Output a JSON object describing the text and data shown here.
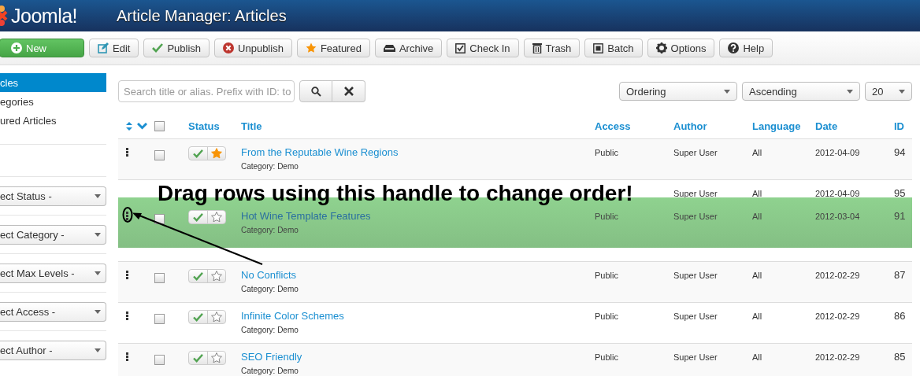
{
  "header": {
    "logo": "Joomla!",
    "title": "Article Manager: Articles"
  },
  "toolbar": [
    {
      "label": "New",
      "kind": "primary"
    },
    {
      "label": "Edit",
      "kind": "default"
    },
    {
      "label": "Publish",
      "kind": "default"
    },
    {
      "label": "Unpublish",
      "kind": "default"
    },
    {
      "label": "Featured",
      "kind": "default"
    },
    {
      "label": "Archive",
      "kind": "default"
    },
    {
      "label": "Check In",
      "kind": "default"
    },
    {
      "label": "Trash",
      "kind": "default"
    },
    {
      "label": "Batch",
      "kind": "default"
    },
    {
      "label": "Options",
      "kind": "default"
    },
    {
      "label": "Help",
      "kind": "default"
    }
  ],
  "sidebar": {
    "items": [
      {
        "label": "cles",
        "selected": true
      },
      {
        "label": "egories",
        "selected": false
      },
      {
        "label": "ured Articles",
        "selected": false
      }
    ],
    "filters": [
      {
        "value": "ect Status -"
      },
      {
        "value": "ect Category -"
      },
      {
        "value": "ect Max Levels -"
      },
      {
        "value": "ect Access -"
      },
      {
        "value": "ect Author -"
      }
    ]
  },
  "search": {
    "placeholder": "Search title or alias. Prefix with ID: to"
  },
  "list_controls": [
    {
      "value": "Ordering"
    },
    {
      "value": "Ascending"
    },
    {
      "value": "20"
    }
  ],
  "table": {
    "header_checked": false,
    "columns": [
      "Status",
      "Title",
      "Access",
      "Author",
      "Language",
      "Date",
      "ID"
    ],
    "rows": [
      {
        "kind": "row",
        "title": "From the Reputable Wine Regions",
        "category": "Category: Demo",
        "access": "Public",
        "author": "Super User",
        "language": "All",
        "date": "2012-04-09",
        "id": "94",
        "published": true,
        "featured": true,
        "checked": false
      },
      {
        "kind": "covered",
        "author": "Super User",
        "language": "All",
        "date": "2012-04-09",
        "id": "95"
      },
      {
        "kind": "row",
        "title": "No Conflicts",
        "category": "Category: Demo",
        "access": "Public",
        "author": "Super User",
        "language": "All",
        "date": "2012-02-29",
        "id": "87",
        "published": true,
        "featured": false,
        "checked": false
      },
      {
        "kind": "row",
        "title": "Infinite Color Schemes",
        "category": "Category: Demo",
        "access": "Public",
        "author": "Super User",
        "language": "All",
        "date": "2012-02-29",
        "id": "86",
        "published": true,
        "featured": false,
        "checked": false
      },
      {
        "kind": "row",
        "title": "SEO Friendly",
        "category": "Category: Demo",
        "access": "Public",
        "author": "Super User",
        "language": "All",
        "date": "2012-02-29",
        "id": "85",
        "published": true,
        "featured": false,
        "checked": false
      }
    ],
    "dragged_row": {
      "title": "Hot Wine Template Features",
      "category": "Category: Demo",
      "access": "Public",
      "author": "Super User",
      "language": "All",
      "date": "2012-03-04",
      "id": "91",
      "published": true,
      "featured": false,
      "checked": false
    },
    "drag_hint": "Drag rows using this handle to change order!"
  }
}
